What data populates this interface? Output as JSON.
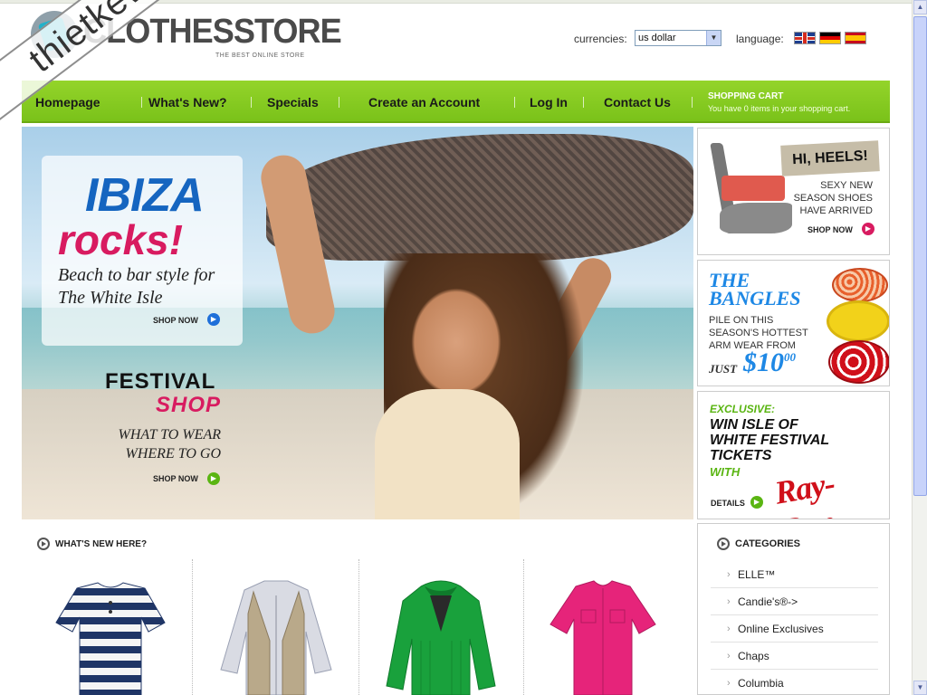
{
  "store": {
    "name": "CLOTHESSTORE",
    "tagline": "THE BEST ONLINE STORE"
  },
  "watermark": "thietkeweb.com",
  "currency": {
    "label": "currencies:",
    "selected": "us dollar"
  },
  "language": {
    "label": "language:",
    "flags": [
      "uk-flag",
      "germany-flag",
      "spain-flag"
    ]
  },
  "nav": {
    "items": [
      "Homepage",
      "What's New?",
      "Specials",
      "Create an Account",
      "Log In",
      "Contact Us"
    ],
    "cart_title": "SHOPPING CART",
    "cart_text": "You have 0 items in your shopping cart."
  },
  "hero": {
    "ibiza": "IBIZA",
    "rocks": "rocks!",
    "beach_line1": "Beach to bar style for",
    "beach_line2": "The White Isle",
    "shop_now": "SHOP NOW",
    "festival": "FESTIVAL",
    "shop_word": "SHOP",
    "what_to_wear": "WHAT TO WEAR",
    "where_to_go": "WHERE TO GO",
    "shop_now2": "SHOP NOW"
  },
  "ads": {
    "heels": {
      "tag": "HI, HEELS!",
      "line1": "SEXY NEW",
      "line2": "SEASON SHOES",
      "line3": "HAVE ARRIVED",
      "shop": "SHOP NOW"
    },
    "bangles": {
      "title1": "THE",
      "title2": "BANGLES",
      "line1": "PILE ON THIS",
      "line2": "SEASON'S HOTTEST",
      "line3": "ARM WEAR FROM",
      "just": "JUST",
      "price": "$10",
      "cents": "00"
    },
    "rayban": {
      "exclusive": "EXCLUSIVE:",
      "win1": "WIN ISLE OF",
      "win2": "WHITE FESTIVAL",
      "win3": "TICKETS",
      "with": "WITH",
      "brand": "Ray-Ban",
      "details": "DETAILS"
    }
  },
  "whats_new": {
    "title": "WHAT'S NEW HERE?",
    "products": [
      "striped-top",
      "vest-and-shirt",
      "green-hoodie",
      "pink-blouse"
    ]
  },
  "categories": {
    "title": "CATEGORIES",
    "items": [
      "ELLE™",
      "Candie's®->",
      "Online Exclusives",
      "Chaps",
      "Columbia"
    ]
  },
  "colors": {
    "nav_green": "#8ccf22",
    "pink": "#d81b60",
    "blue": "#1565c0",
    "shop_green": "#5ab512"
  }
}
